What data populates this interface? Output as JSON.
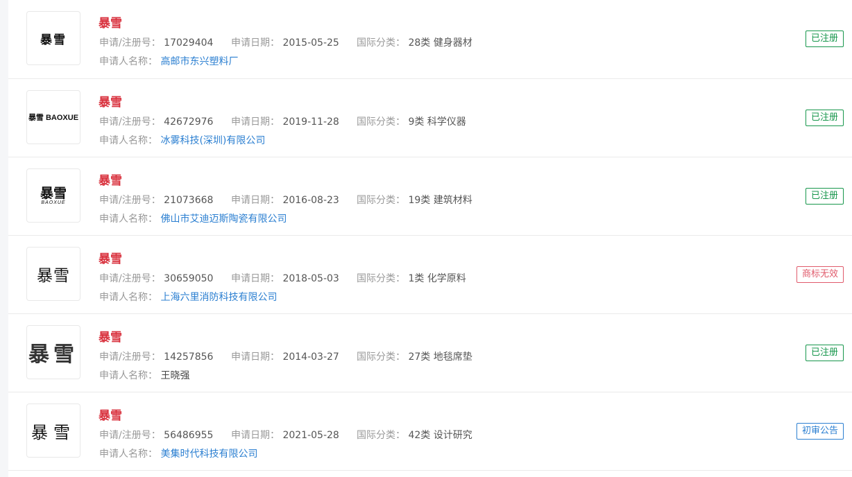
{
  "labels": {
    "reg_no": "申请/注册号：",
    "apply_date": "申请日期：",
    "intl_class": "国际分类：",
    "applicant": "申请人名称："
  },
  "colors": {
    "name_red": "#d9333f",
    "status_registered": "#16964b",
    "status_invalid": "#e05a6b",
    "status_announcement": "#2b7fd1",
    "applicant_link": "#2b7fd1"
  },
  "items": [
    {
      "logo": {
        "text": "暴雪"
      },
      "name": "暴雪",
      "reg_no": "17029404",
      "apply_date": "2015-05-25",
      "intl_class": "28类 健身器材",
      "applicant": "高邮市东兴塑料厂",
      "status": "已注册"
    },
    {
      "logo": {
        "text": "暴雪 BAOXUE"
      },
      "name": "暴雪",
      "reg_no": "42672976",
      "apply_date": "2019-11-28",
      "intl_class": "9类 科学仪器",
      "applicant": "冰雾科技(深圳)有限公司",
      "status": "已注册"
    },
    {
      "logo": {
        "text": "暴雪",
        "sub": "BAOXUE"
      },
      "name": "暴雪",
      "reg_no": "21073668",
      "apply_date": "2016-08-23",
      "intl_class": "19类 建筑材料",
      "applicant": "佛山市艾迪迈斯陶瓷有限公司",
      "status": "已注册"
    },
    {
      "logo": {
        "text": "暴雪"
      },
      "name": "暴雪",
      "reg_no": "30659050",
      "apply_date": "2018-05-03",
      "intl_class": "1类 化学原料",
      "applicant": "上海六里消防科技有限公司",
      "status": "商标无效"
    },
    {
      "logo": {
        "text": "暴雪"
      },
      "name": "暴雪",
      "reg_no": "14257856",
      "apply_date": "2014-03-27",
      "intl_class": "27类 地毯席垫",
      "applicant": "王晓强",
      "status": "已注册"
    },
    {
      "logo": {
        "text": "暴雪"
      },
      "name": "暴雪",
      "reg_no": "56486955",
      "apply_date": "2021-05-28",
      "intl_class": "42类 设计研究",
      "applicant": "美集时代科技有限公司",
      "status": "初审公告"
    }
  ]
}
